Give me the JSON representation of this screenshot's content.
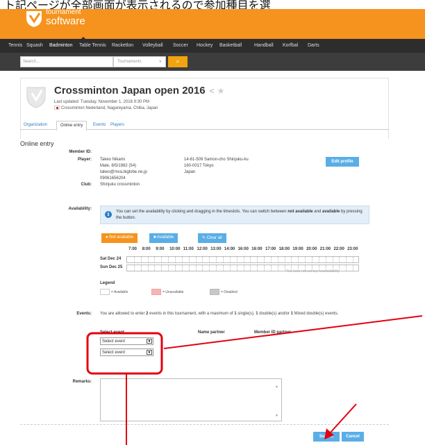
{
  "top_strip": "ト記ページが全部画面が表示されるので参加種目を選",
  "brand": {
    "line1": "tournament",
    "line2": "software"
  },
  "sports_nav": [
    "Tennis",
    "Squash",
    "Badminton",
    "Table Tennis",
    "Racketlon",
    "Volleyball",
    "Soccer",
    "Hockey",
    "Basketball",
    "Handball",
    "Korfbal",
    "Darts"
  ],
  "search": {
    "placeholder": "Search...",
    "scope": "Tournaments",
    "chevron": "∨",
    "button_glyph": "⌕"
  },
  "tournament": {
    "title": "Crossminton Japan open 2016",
    "updated": "Last updated: Tuesday, November 1, 2016 9:30 PM",
    "location": "Crossminton Nederland, Nagareyama, Chiba, Japan"
  },
  "tabs": [
    "Organization",
    "Online entry",
    "Events",
    "Players"
  ],
  "heading": "Online entry",
  "member": {
    "id_label": "Member ID:",
    "player_label": "Player:",
    "name": "Takeo Nikami",
    "details": "Male, 8/5/1982 (54)",
    "email": "takeo@mva.biglobe.ne.jp",
    "phone": "09061656204",
    "address1": "14-61-509 Samon-cho Shinjuku-ku",
    "address2": "160-0017 Tokyo",
    "country": "Japan",
    "club_label": "Club:",
    "club": "Shinjuku crossminton",
    "edit_button": "Edit profile"
  },
  "availability": {
    "label": "Availability:",
    "info_icon": "i",
    "info_text_a": "You can set the availability by clicking and dragging in the timeslots. You can switch between ",
    "info_bold_1": "not available",
    "info_and": " and ",
    "info_bold_2": "available",
    "info_text_b": " by pressing the button.",
    "btn_not_available": "● Not available",
    "btn_available": "■ Available",
    "btn_clear": "✎ Clear all",
    "hours": [
      "7:00",
      "8:00",
      "9:00",
      "10:00",
      "11:00",
      "12:00",
      "13:00",
      "14:00",
      "16:00",
      "16:00",
      "17:00",
      "18:00",
      "19:00",
      "20:00",
      "21:00",
      "22:00",
      "23:00"
    ],
    "days": [
      "Sat Dec 24",
      "Sun Dec 25"
    ],
    "none_set": "You have not set any unavailability"
  },
  "legend": {
    "title": "Legend",
    "available": "= Available",
    "unavailable": "= Unavailable",
    "disabled": "= Disabled"
  },
  "events": {
    "label": "Events:",
    "text_a": "You are allowed to enter ",
    "n_events": "2",
    "text_b": " events in this tournament, with a maximum of ",
    "n_single": "1",
    "text_c": " single(s), ",
    "n_double": "1",
    "text_d": " double(s) and/or ",
    "n_mixed": "1",
    "text_e": " Mixed double(s) events.",
    "col_select": "Select event",
    "col_partner": "Name partner",
    "col_member_id": "Member ID partner",
    "select_placeholder": "Select event",
    "select_arrow": "▼"
  },
  "remarks": {
    "label": "Remarks:",
    "up": "▲",
    "down": "▼"
  },
  "actions": {
    "submit": "Submit",
    "cancel": "Cancel"
  },
  "colors": {
    "orange": "#f6931e",
    "annotation_red": "#e3000f",
    "button_blue": "#5aaee6"
  }
}
